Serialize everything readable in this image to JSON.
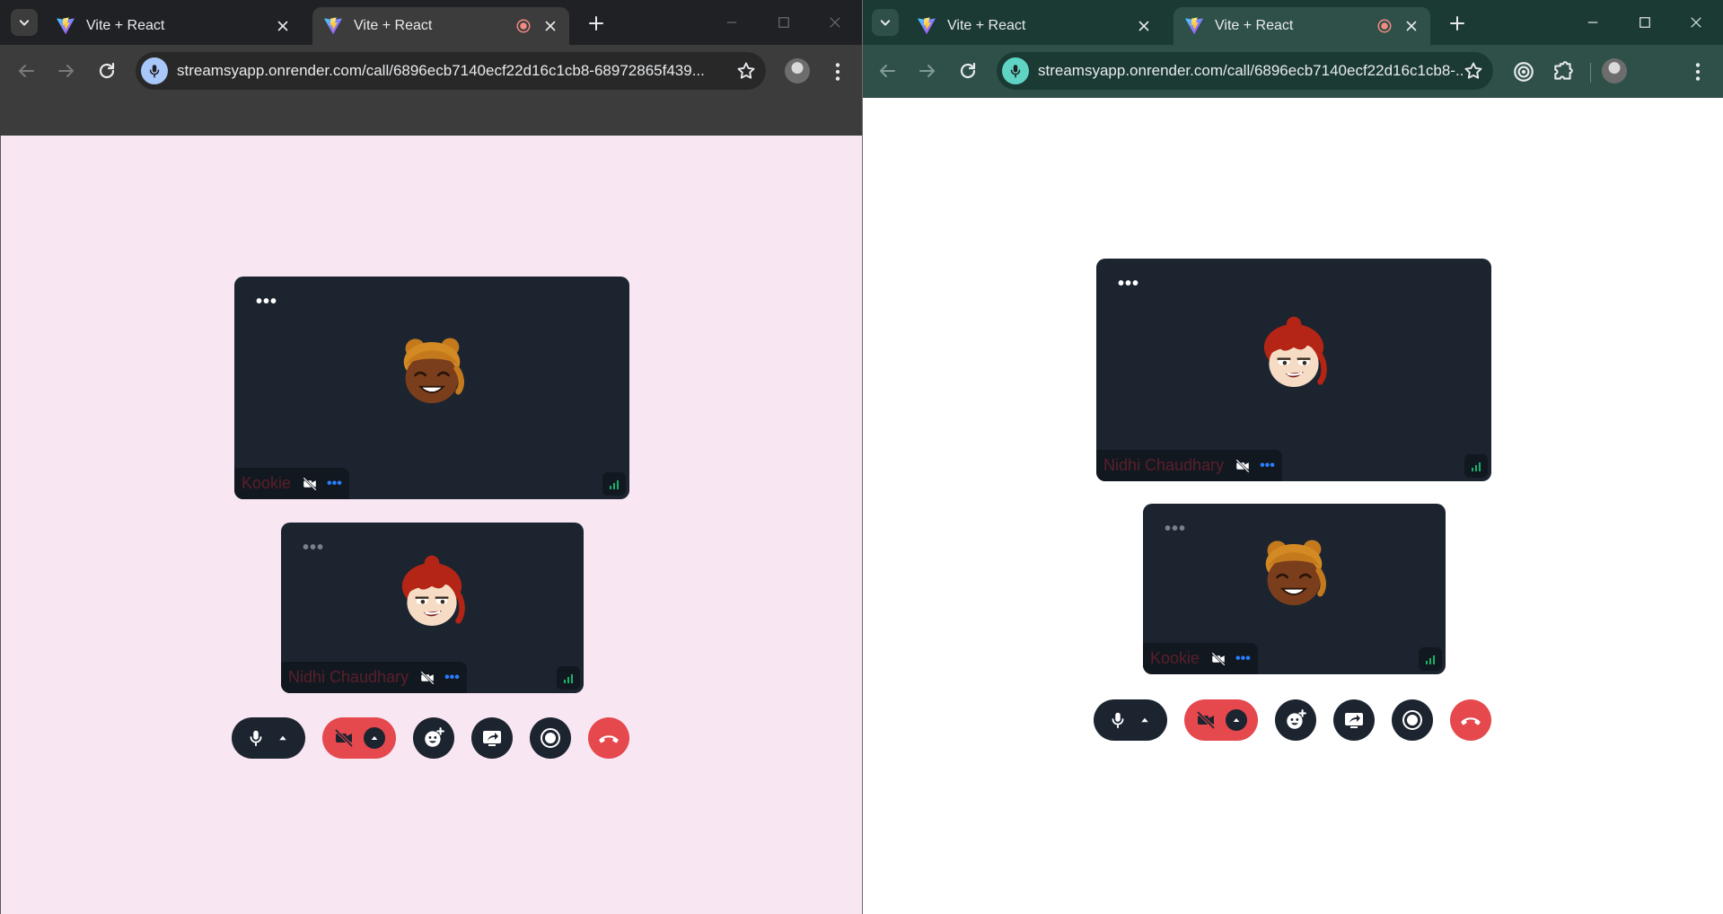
{
  "left_window": {
    "tabs": [
      {
        "title": "Vite + React",
        "active": false,
        "recording": false
      },
      {
        "title": "Vite + React",
        "active": true,
        "recording": true
      }
    ],
    "url": "streamsyapp.onrender.com/call/6896ecb7140ecf22d16c1cb8-68972865f439...",
    "tiles": [
      {
        "participant": "Kookie",
        "avatar": "brown-hair-smiling-avatar",
        "menu_dim": false
      },
      {
        "participant": "Nidhi Chaudhary",
        "avatar": "red-hair-smirking-avatar",
        "menu_dim": true
      }
    ]
  },
  "right_window": {
    "tabs": [
      {
        "title": "Vite + React",
        "active": false,
        "recording": false
      },
      {
        "title": "Vite + React",
        "active": true,
        "recording": true
      }
    ],
    "url": "streamsyapp.onrender.com/call/6896ecb7140ecf22d16c1cb8-...",
    "tiles": [
      {
        "participant": "Nidhi Chaudhary",
        "avatar": "red-hair-smirking-avatar",
        "menu_dim": false
      },
      {
        "participant": "Kookie",
        "avatar": "brown-hair-smiling-avatar",
        "menu_dim": true
      }
    ]
  },
  "call_controls": [
    {
      "name": "microphone",
      "icon": "mic-icon",
      "has_dropdown": true,
      "state": "on"
    },
    {
      "name": "camera",
      "icon": "camera-off-icon",
      "has_dropdown": true,
      "state": "off"
    },
    {
      "name": "reactions",
      "icon": "emoji-add-icon",
      "has_dropdown": false
    },
    {
      "name": "screen-share",
      "icon": "screen-share-icon",
      "has_dropdown": false
    },
    {
      "name": "record",
      "icon": "record-icon",
      "has_dropdown": false
    },
    {
      "name": "leave-call",
      "icon": "hang-up-icon",
      "has_dropdown": false
    }
  ],
  "colors": {
    "left_chrome": "#3c3c3c",
    "right_chrome": "#2f5049",
    "left_page_bg": "#f8e6f3",
    "right_page_bg": "#ffffff",
    "tile_bg": "#1c2430",
    "danger": "#e5484d",
    "signal": "#19b26b",
    "participant_name": "#5a1f2a"
  }
}
